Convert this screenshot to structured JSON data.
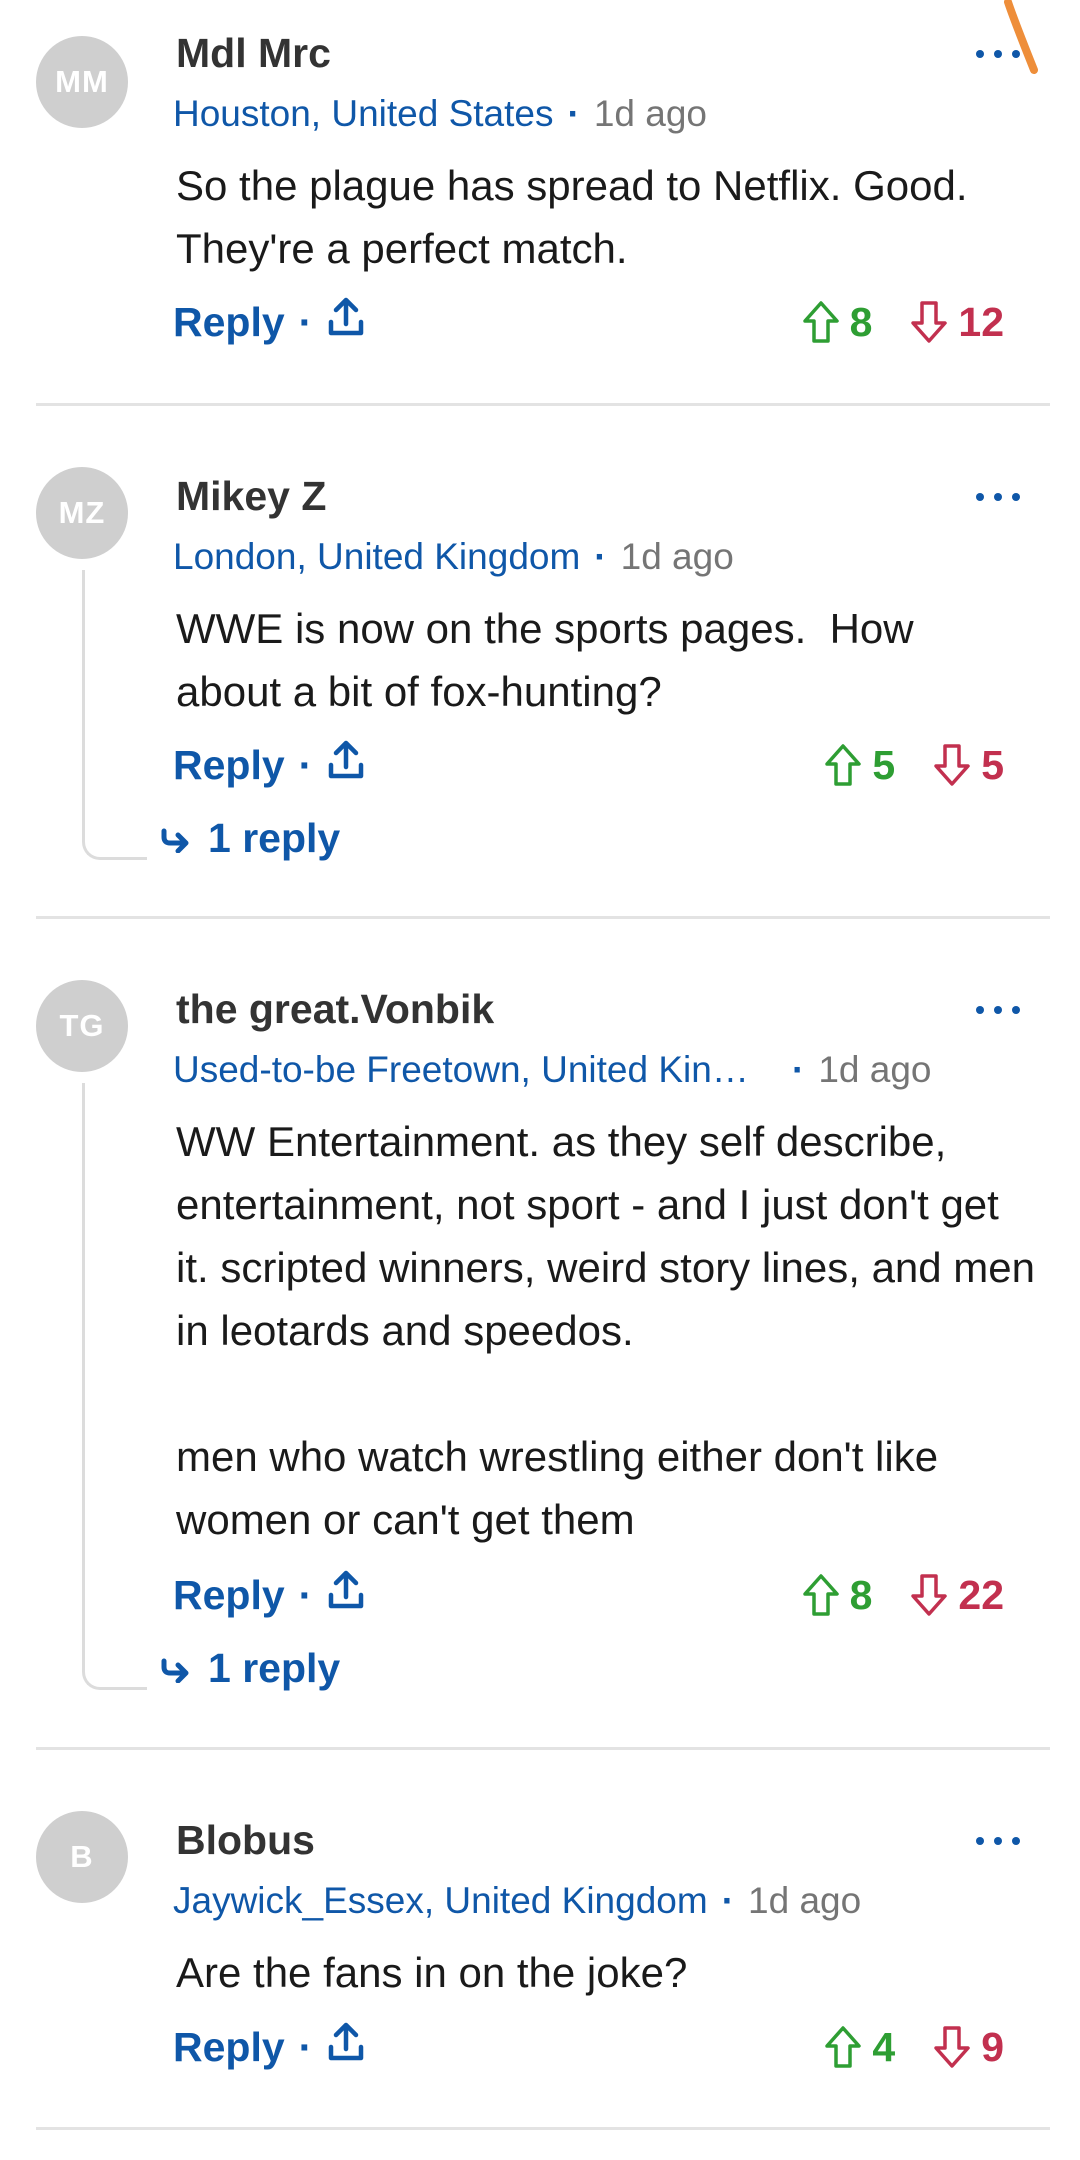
{
  "comments": [
    {
      "initials": "MM",
      "username": "Mdl Mrc",
      "location": "Houston, United States",
      "time": "1d ago",
      "body": "So the plague has spread to Netflix. Good. They're a perfect match.",
      "reply_label": "Reply",
      "upvotes": "8",
      "downvotes": "12"
    },
    {
      "initials": "MZ",
      "username": "Mikey Z",
      "location": "London, United Kingdom",
      "time": "1d ago",
      "body": "WWE is now on the sports pages.  How about a bit of fox-hunting?",
      "reply_label": "Reply",
      "upvotes": "5",
      "downvotes": "5",
      "replies_label": "1 reply"
    },
    {
      "initials": "TG",
      "username": "the great.Vonbik",
      "location": "Used-to-be Freetown, United Kingdom",
      "time": "1d ago",
      "body": "WW Entertainment. as they self describe, entertainment, not sport - and I just don't get it. scripted winners, weird story lines, and men in leotards and speedos.\n\nmen who watch wrestling either don't like women or can't get them",
      "reply_label": "Reply",
      "upvotes": "8",
      "downvotes": "22",
      "replies_label": "1 reply"
    },
    {
      "initials": "B",
      "username": "Blobus",
      "location": "Jaywick_Essex, United Kingdom",
      "time": "1d ago",
      "body": "Are the fans in on the joke?",
      "reply_label": "Reply",
      "upvotes": "4",
      "downvotes": "9"
    }
  ],
  "colors": {
    "link_blue": "#0f57a8",
    "upvote_green": "#2e9e33",
    "downvote_red": "#c2304f",
    "avatar_grey": "#cfcfcf"
  },
  "icons": [
    "share-icon",
    "upvote-arrow-icon",
    "downvote-arrow-icon",
    "more-options-icon",
    "reply-arrow-icon"
  ]
}
